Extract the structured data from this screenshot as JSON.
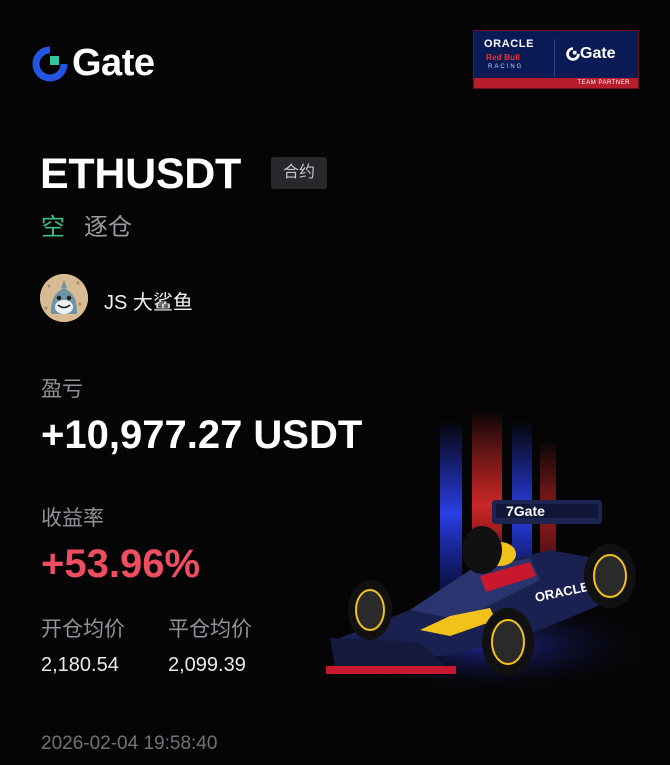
{
  "brand": {
    "name": "Gate",
    "logo_icon": "gate-logo-icon",
    "accent": "#2354e6"
  },
  "partner_banner": {
    "sponsor": "ORACLE",
    "team": "Red Bull",
    "racing": "RACING",
    "brand": "Gate",
    "tag": "TEAM PARTNER"
  },
  "position": {
    "pair": "ETHUSDT",
    "type_badge": "合约",
    "side": "空",
    "side_color": "#3fc089",
    "margin_mode": "逐仓"
  },
  "user": {
    "avatar_icon": "shark-avatar-icon",
    "name": "JS 大鲨鱼"
  },
  "pnl": {
    "label": "盈亏",
    "value": "+10,977.27 USDT"
  },
  "roi": {
    "label": "收益率",
    "value": "+53.96%",
    "color": "#ef4d61"
  },
  "prices": {
    "open_label": "开仓均价",
    "open_value": "2,180.54",
    "close_label": "平仓均价",
    "close_value": "2,099.39"
  },
  "timestamp": "2026-02-04 19:58:40",
  "illustration": {
    "icon": "f1-race-car-icon",
    "livery": "Gate"
  }
}
